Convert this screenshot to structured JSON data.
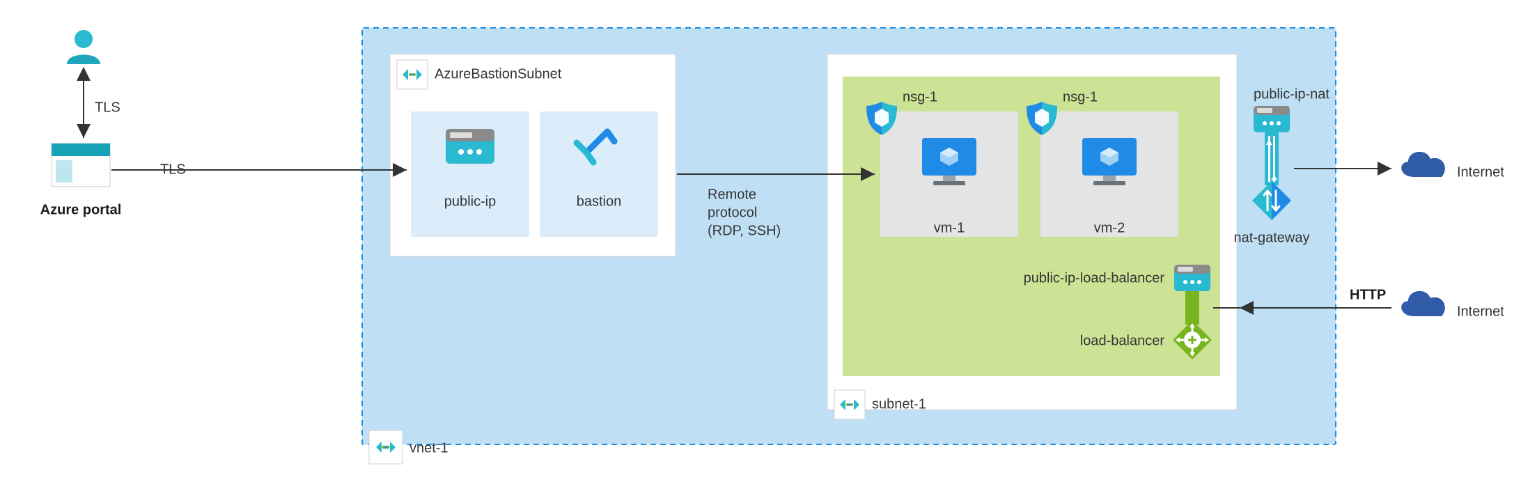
{
  "left": {
    "portal_label": "Azure portal",
    "tls_vertical": "TLS",
    "tls_horizontal": "TLS"
  },
  "vnet": {
    "label": "vnet-1",
    "bastion_subnet_label": "AzureBastionSubnet",
    "public_ip_label": "public-ip",
    "bastion_label": "bastion",
    "remote_protocol_line1": "Remote",
    "remote_protocol_line2": "protocol",
    "remote_protocol_line3": "(RDP, SSH)"
  },
  "subnet": {
    "label": "subnet-1",
    "nsg1_label": "nsg-1",
    "nsg2_label": "nsg-1",
    "vm1_label": "vm-1",
    "vm2_label": "vm-2",
    "public_ip_lb_label": "public-ip-load-balancer",
    "load_balancer_label": "load-balancer"
  },
  "right": {
    "public_ip_nat_label": "public-ip-nat",
    "nat_gateway_label": "nat-gateway",
    "internet_top_label": "Internet",
    "internet_bottom_label": "Internet",
    "http_label": "HTTP"
  },
  "colors": {
    "vnet_fill": "#bfe0f4",
    "vnet_border": "#1b8ce3",
    "subnet_white": "#ffffff",
    "subnet_green": "#cce294",
    "card_blue": "#dbedfb",
    "vm_card": "#e4e4e4",
    "azure_cyan": "#29b9d1",
    "azure_blue": "#1f8be6",
    "cloud_blue": "#305ba6",
    "lb_green": "#78b41d"
  }
}
